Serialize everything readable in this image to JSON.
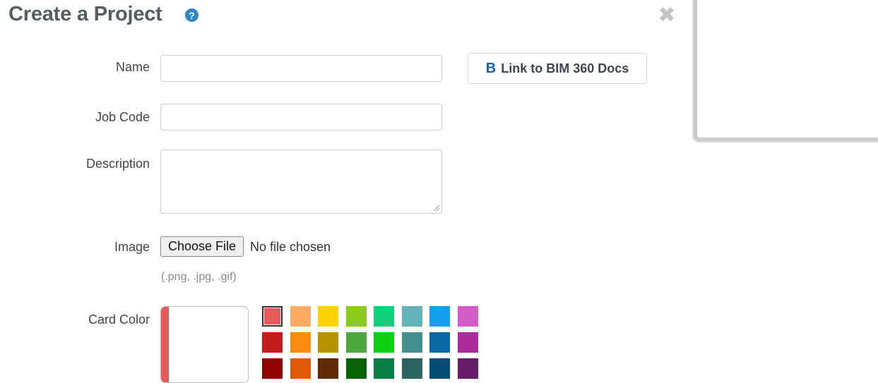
{
  "dialog": {
    "title": "Create a Project",
    "help_icon": "question-circle-icon",
    "help_glyph": "?",
    "close_icon": "close-x-icon",
    "close_glyph": "✖"
  },
  "form": {
    "name": {
      "label": "Name",
      "value": ""
    },
    "job_code": {
      "label": "Job Code",
      "value": ""
    },
    "description": {
      "label": "Description",
      "value": ""
    },
    "image": {
      "label": "Image",
      "button_label": "Choose File",
      "status": "No file chosen",
      "hint": "(.png, .jpg, .gif)"
    },
    "card_color": {
      "label": "Card Color",
      "selected": "#e85a5a",
      "swatches": [
        "#e85a5a",
        "#fcaa64",
        "#fcd200",
        "#8bca1e",
        "#0fd07b",
        "#65b3b8",
        "#149eee",
        "#d35cc8",
        "#c31c1c",
        "#fb8a10",
        "#b49400",
        "#4ea741",
        "#0dd10f",
        "#428f8e",
        "#0a69a3",
        "#ab2b9c",
        "#920404",
        "#e0590b",
        "#5e2d07",
        "#076306",
        "#087f46",
        "#2b6462",
        "#034c74",
        "#681b67"
      ]
    }
  },
  "bim_link": {
    "icon": "bim-360-b-icon",
    "glyph": "B",
    "label": "Link to BIM 360 Docs"
  }
}
